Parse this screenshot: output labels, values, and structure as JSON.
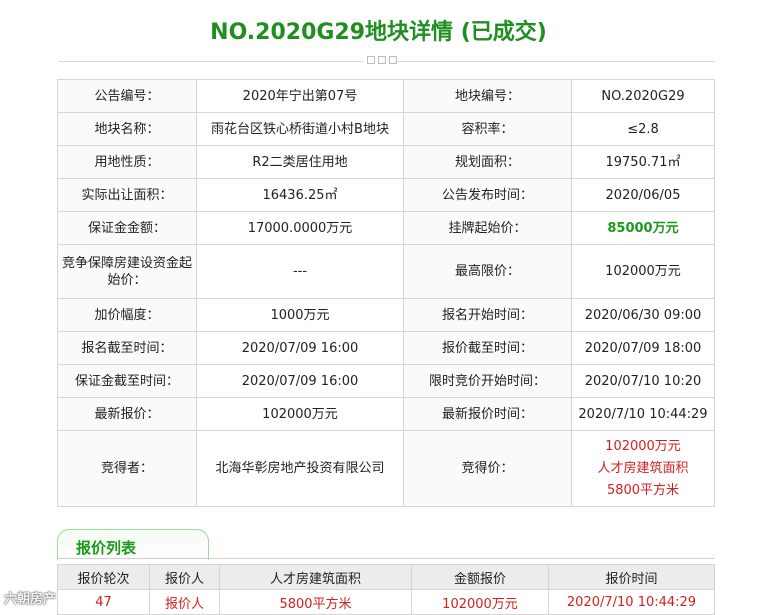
{
  "page": {
    "title": "NO.2020G29地块详情 (已成交)"
  },
  "detail": {
    "rows": [
      {
        "l1": "公告编号：",
        "v1": "2020年宁出第07号",
        "l2": "地块编号：",
        "v2": "NO.2020G29"
      },
      {
        "l1": "地块名称：",
        "v1": "雨花台区铁心桥街道小村B地块",
        "l2": "容积率：",
        "v2": "≤2.8"
      },
      {
        "l1": "用地性质：",
        "v1": "R2二类居住用地",
        "l2": "规划面积：",
        "v2": "19750.71㎡"
      },
      {
        "l1": "实际出让面积：",
        "v1": "16436.25㎡",
        "l2": "公告发布时间：",
        "v2": "2020/06/05"
      },
      {
        "l1": "保证金金额：",
        "v1": "17000.0000万元",
        "l2": "挂牌起始价：",
        "v2": "85000万元"
      },
      {
        "l1": "竞争保障房建设资金起始价：",
        "v1": "---",
        "l2": "最高限价：",
        "v2": "102000万元"
      },
      {
        "l1": "加价幅度：",
        "v1": "1000万元",
        "l2": "报名开始时间：",
        "v2": "2020/06/30 09:00"
      },
      {
        "l1": "报名截至时间：",
        "v1": "2020/07/09 16:00",
        "l2": "报价截至时间：",
        "v2": "2020/07/09 18:00"
      },
      {
        "l1": "保证金截至时间：",
        "v1": "2020/07/09 16:00",
        "l2": "限时竞价开始时间：",
        "v2": "2020/07/10 10:20"
      },
      {
        "l1": "最新报价：",
        "v1": "102000万元",
        "l2": "最新报价时间：",
        "v2": "2020/7/10 10:44:29"
      },
      {
        "l1": "竞得者：",
        "v1": "北海华彰房地产投资有限公司",
        "l2": "竞得价：",
        "v2a": "102000万元",
        "v2b": "人才房建筑面积",
        "v2c": "5800平方米"
      }
    ]
  },
  "bids": {
    "tab_label": "报价列表",
    "headers": [
      "报价轮次",
      "报价人",
      "人才房建筑面积",
      "金额报价",
      "报价时间"
    ],
    "rows": [
      [
        "47",
        "报价人",
        "5800平方米",
        "102000万元",
        "2020/7/10 10:44:29"
      ]
    ]
  },
  "watermark": "六朝房产"
}
